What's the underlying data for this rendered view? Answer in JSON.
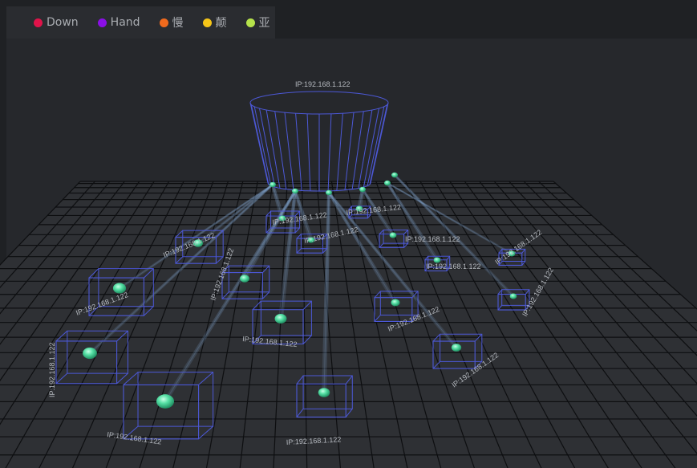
{
  "legend": [
    {
      "label": "Down",
      "color": "#e0134a"
    },
    {
      "label": "Hand",
      "color": "#8a0fe6"
    },
    {
      "label": "慢",
      "color": "#f06a1d"
    },
    {
      "label": "颠",
      "color": "#f5c518"
    },
    {
      "label": "亚",
      "color": "#b6e34b"
    }
  ],
  "server": {
    "label": "IP:192.168.1.122"
  },
  "nodes": [
    {
      "label": "IP:192.168.1.122"
    },
    {
      "label": "IP:192.168.1.122"
    },
    {
      "label": "IP:192.168.1.122"
    },
    {
      "label": "IP:192.168.1.122"
    },
    {
      "label": "IP:192.168.1.122"
    },
    {
      "label": "IP:192.168.1.122"
    },
    {
      "label": "IP:192.168.1.122"
    },
    {
      "label": "IP:192.168.1.122"
    },
    {
      "label": "IP:192.168.1.122"
    },
    {
      "label": "IP:192.168.1.122"
    },
    {
      "label": "IP:192.168.1.122"
    },
    {
      "label": "IP:192.168.1.122"
    },
    {
      "label": "IP:192.168.1.122"
    },
    {
      "label": "IP:192.168.1.122"
    },
    {
      "label": "IP:192.168.1.122"
    },
    {
      "label": "IP:192.168.1.122"
    }
  ],
  "colors": {
    "wireframe": "#4c58d6",
    "sphere": "#56e0a5",
    "grid": "#0d0e10",
    "beam": "#8ab4e6"
  }
}
